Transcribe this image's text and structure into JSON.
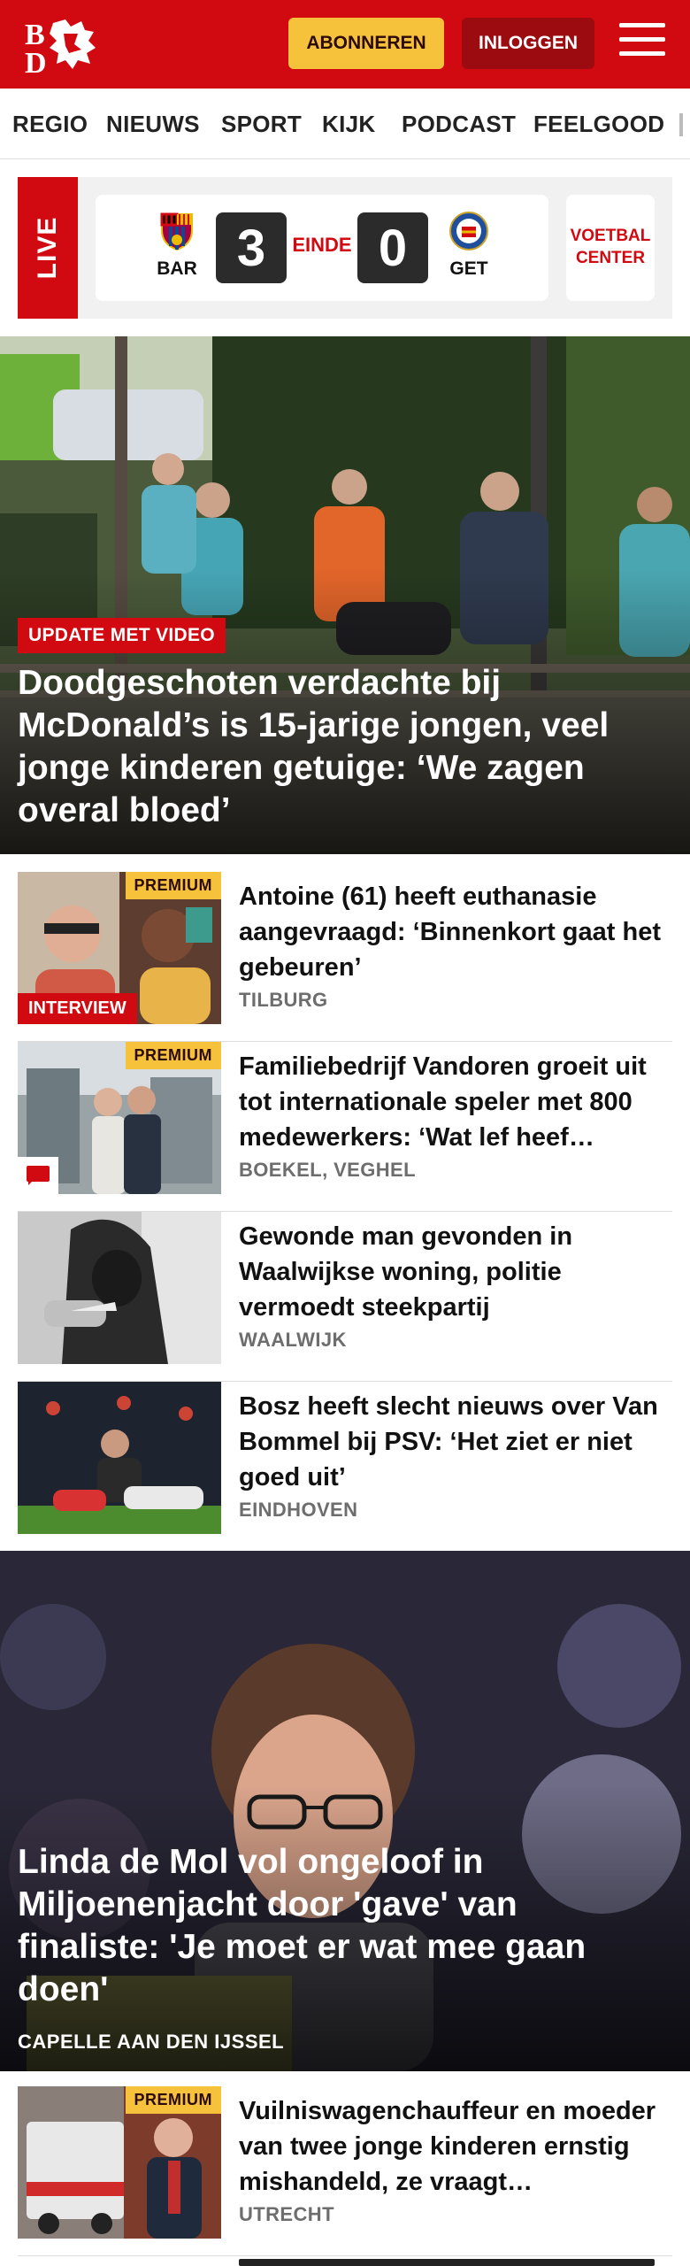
{
  "header": {
    "logo_text": "BD",
    "subscribe_label": "ABONNEREN",
    "login_label": "INLOGGEN"
  },
  "nav": {
    "items": [
      "REGIO",
      "NIEUWS",
      "SPORT",
      "KIJK",
      "PODCAST",
      "FEELGOOD"
    ]
  },
  "live": {
    "tag": "LIVE",
    "home_team": "BAR",
    "away_team": "GET",
    "home_score": "3",
    "away_score": "0",
    "status": "EINDE",
    "voetbal_center": "VOETBAL CENTER"
  },
  "hero": {
    "label": "UPDATE MET VIDEO",
    "title": "Doodgeschoten verdachte bij McDonald’s is 15-jarige jongen, veel jonge kinderen getuige: ‘We zagen overal bloed’"
  },
  "articles": [
    {
      "premium": "PREMIUM",
      "tag": "INTERVIEW",
      "title": "Antoine (61) heeft euthanasie aangevraagd: ‘Binnenkort gaat het gebeuren’",
      "location": "TILBURG"
    },
    {
      "premium": "PREMIUM",
      "title": "Familiebedrijf Vandoren groeit uit tot internationale speler met 800 medewerkers: ‘Wat lef heef…",
      "location": "BOEKEL, VEGHEL"
    },
    {
      "title": "Gewonde man gevonden in Waalwijkse woning, politie vermoedt steekpartij",
      "location": "WAALWIJK"
    },
    {
      "title": "Bosz heeft slecht nieuws over Van Bommel bij PSV: ‘Het ziet er niet goed uit’",
      "location": "EINDHOVEN"
    }
  ],
  "hero2": {
    "title": "Linda de Mol vol ongeloof in Miljoenenjacht door 'gave' van finaliste: 'Je moet er wat mee gaan doen'",
    "location": "CAPELLE AAN DEN IJSSEL"
  },
  "article_last": {
    "premium": "PREMIUM",
    "title": "Vuilniswagenchauffeur en moeder van twee jonge kinderen ernstig mishandeld, ze vraagt…",
    "location": "UTRECHT"
  },
  "colors": {
    "brand_red": "#d10a11",
    "premium_yellow": "#f6c23c",
    "dark_red": "#9c0b10"
  }
}
